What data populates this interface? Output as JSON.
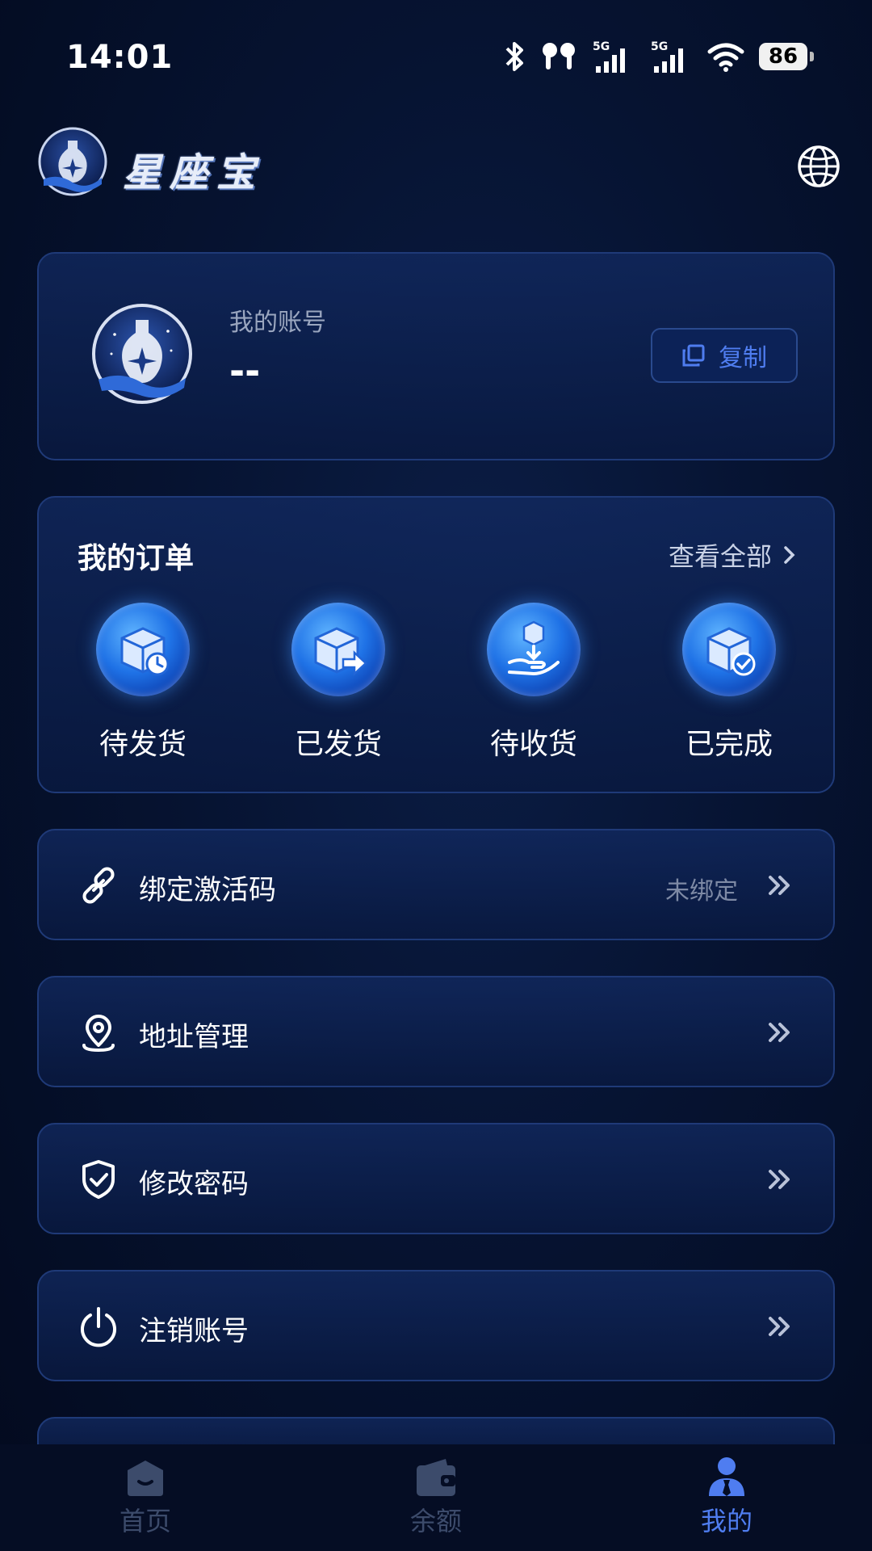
{
  "status_bar": {
    "time": "14:01",
    "network": "5G",
    "battery": "86"
  },
  "header": {
    "app_name": "星座宝"
  },
  "account": {
    "label": "我的账号",
    "value": "--",
    "copy_label": "复制"
  },
  "orders": {
    "title": "我的订单",
    "view_all": "查看全部",
    "items": [
      {
        "label": "待发货",
        "icon": "box-clock-icon"
      },
      {
        "label": "已发货",
        "icon": "box-arrow-icon"
      },
      {
        "label": "待收货",
        "icon": "box-hand-icon"
      },
      {
        "label": "已完成",
        "icon": "box-check-icon"
      }
    ]
  },
  "menu": [
    {
      "label": "绑定激活码",
      "status": "未绑定",
      "icon": "link-icon"
    },
    {
      "label": "地址管理",
      "status": "",
      "icon": "location-pin-icon"
    },
    {
      "label": "修改密码",
      "status": "",
      "icon": "shield-check-icon"
    },
    {
      "label": "注销账号",
      "status": "",
      "icon": "power-icon"
    }
  ],
  "tab_bar": {
    "items": [
      {
        "label": "首页",
        "icon": "home-icon",
        "active": false
      },
      {
        "label": "余额",
        "icon": "wallet-icon",
        "active": false
      },
      {
        "label": "我的",
        "icon": "user-icon",
        "active": true
      }
    ]
  },
  "colors": {
    "accent": "#4f7df0",
    "background": "#061331",
    "card_border": "#1f3a78",
    "inactive_tab": "#3c4b6b"
  }
}
